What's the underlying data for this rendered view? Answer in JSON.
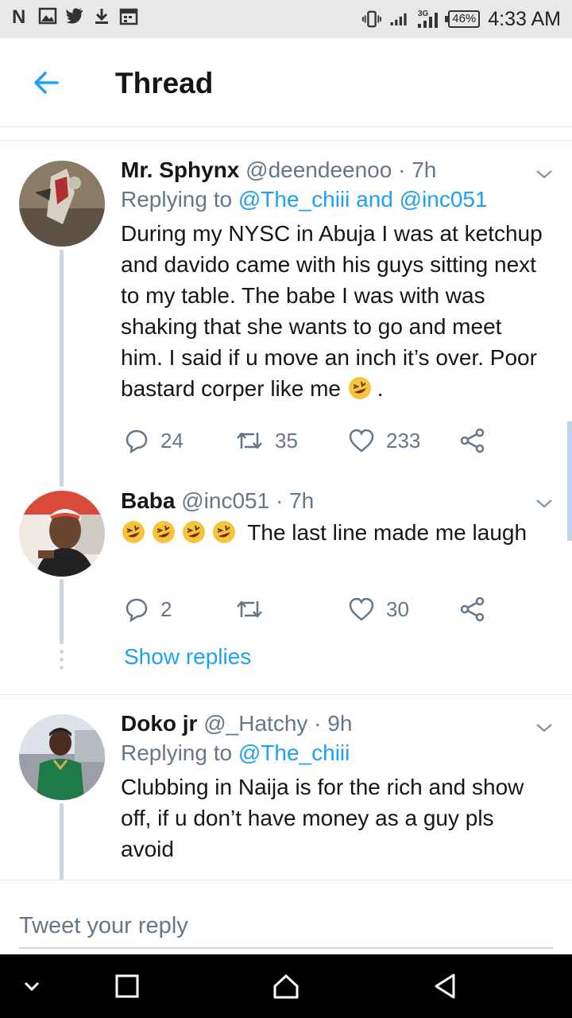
{
  "status_bar": {
    "time": "4:33 AM",
    "battery": "46%",
    "network": "3G",
    "left_icons": [
      "netflix-icon",
      "gallery-icon",
      "twitter-icon",
      "download-icon",
      "calendar-icon"
    ]
  },
  "header": {
    "title": "Thread",
    "back_icon": "arrow-left-icon"
  },
  "tweets": [
    {
      "name": "Mr. Sphynx",
      "handle": "@deendeenoo",
      "dot": "·",
      "time": "7h",
      "replying_prefix": "Replying to",
      "replying_to_1": "@The_chiii",
      "replying_and": "and",
      "replying_to_2": "@inc051",
      "text": "During my NYSC in Abuja I was at ketchup and davido came with his guys sitting next to my table. The babe I was with was shaking that she wants to go and meet him. I said if u move an inch it’s over. Poor bastard corper like me",
      "text_end": ".",
      "replies": "24",
      "retweets": "35",
      "likes": "233"
    },
    {
      "name": "Baba",
      "handle": "@inc051",
      "dot": "·",
      "time": "7h",
      "text": "The last line made me laugh",
      "replies": "2",
      "retweets": "",
      "likes": "30",
      "show_replies": "Show replies"
    },
    {
      "name": "Doko jr",
      "handle": "@_Hatchy",
      "dot": "·",
      "time": "9h",
      "replying_prefix": "Replying to",
      "replying_to_1": "@The_chiii",
      "text": "Clubbing in Naija is for the rich and show off, if u don’t have money as a guy pls avoid"
    }
  ],
  "composer": {
    "placeholder": "Tweet your reply"
  },
  "colors": {
    "accent": "#1da1f2",
    "muted": "#657786",
    "text": "#14171a",
    "thread_line": "#ccd6dd"
  }
}
